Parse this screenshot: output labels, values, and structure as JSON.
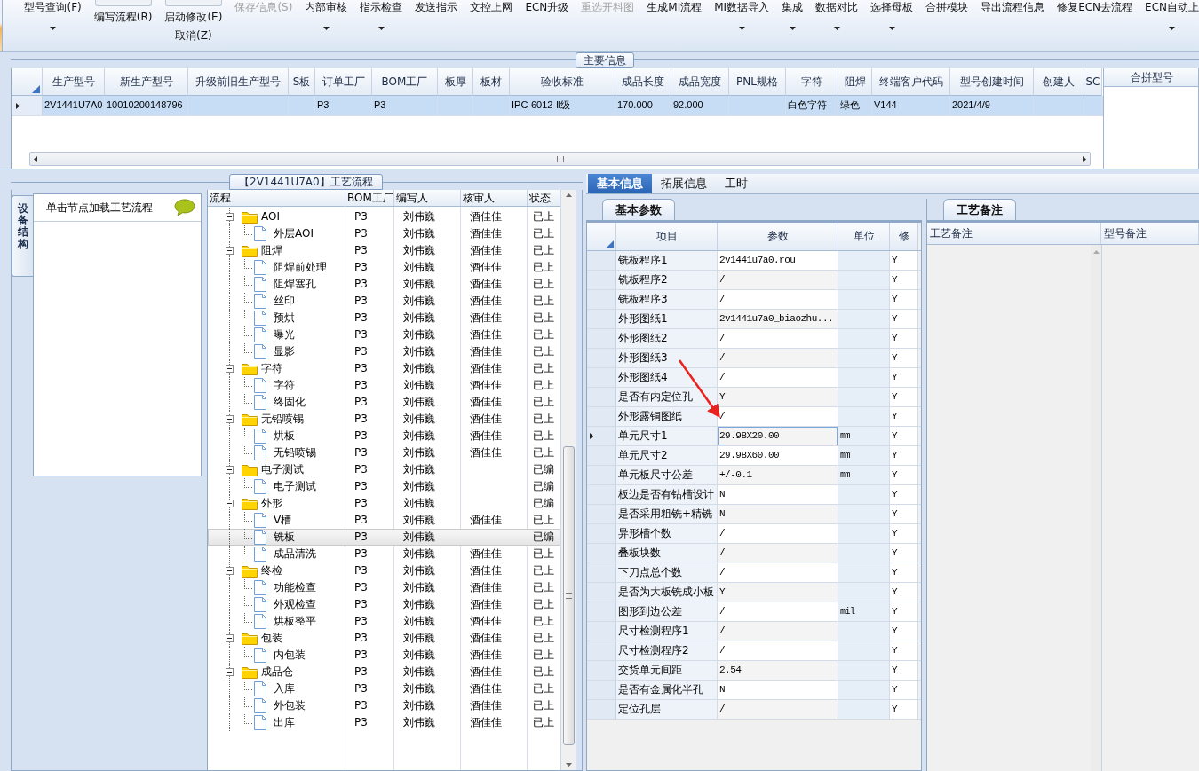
{
  "toolbar": [
    {
      "label": "型号查询(F)",
      "kind": "text",
      "dropdown": true,
      "disabled": false
    },
    {
      "label": "编写流程(R)",
      "kind": "icon",
      "dropdown": false,
      "disabled": false
    },
    {
      "label": "启动修改(E)",
      "second_label": "取消(Z)",
      "kind": "icon",
      "dropdown": false,
      "disabled": false
    },
    {
      "label": "保存信息(S)",
      "kind": "text",
      "dropdown": false,
      "disabled": true
    },
    {
      "label": "内部审核",
      "kind": "text",
      "dropdown": true,
      "disabled": false
    },
    {
      "label": "指示检查",
      "kind": "text",
      "dropdown": true,
      "disabled": false
    },
    {
      "label": "发送指示",
      "kind": "text",
      "dropdown": false,
      "disabled": false
    },
    {
      "label": "文控上网",
      "kind": "text",
      "dropdown": false,
      "disabled": false
    },
    {
      "label": "ECN升级",
      "kind": "text",
      "dropdown": false,
      "disabled": false
    },
    {
      "label": "重选开料图",
      "kind": "text",
      "dropdown": false,
      "disabled": true
    },
    {
      "label": "生成MI流程",
      "kind": "text",
      "dropdown": false,
      "disabled": false
    },
    {
      "label": "MI数据导入",
      "kind": "text",
      "dropdown": true,
      "disabled": false
    },
    {
      "label": "集成",
      "kind": "text",
      "dropdown": true,
      "disabled": false
    },
    {
      "label": "数据对比",
      "kind": "text",
      "dropdown": true,
      "disabled": false
    },
    {
      "label": "选择母板",
      "kind": "text",
      "dropdown": true,
      "disabled": false
    },
    {
      "label": "合拼模块",
      "kind": "text",
      "dropdown": false,
      "disabled": false
    },
    {
      "label": "导出流程信息",
      "kind": "text",
      "dropdown": false,
      "disabled": false
    },
    {
      "label": "修复ECN去流程",
      "kind": "text",
      "dropdown": false,
      "disabled": false
    },
    {
      "label": "ECN自动上",
      "kind": "text",
      "dropdown": true,
      "disabled": false
    }
  ],
  "main_info": {
    "title": "主要信息",
    "columns": [
      "生产型号",
      "新生产型号",
      "升级前旧生产型号",
      "S板",
      "订单工厂",
      "BOM工厂",
      "板厚",
      "板材",
      "验收标准",
      "成品长度",
      "成品宽度",
      "PNL规格",
      "字符",
      "阻焊",
      "终端客户代码",
      "型号创建时间",
      "创建人",
      "SC"
    ],
    "rows": [
      {
        "selected": true,
        "cells": [
          "2V1441U7A0",
          "10010200148796",
          null,
          null,
          "P3",
          "P3",
          null,
          null,
          "IPC-6012 Ⅱ级",
          "170.000",
          "92.000",
          null,
          "白色字符",
          "绿色",
          "V144",
          "2021/4/9",
          null,
          null
        ]
      }
    ],
    "side_column": "合拼型号"
  },
  "flow": {
    "title": "【2V1441U7A0】工艺流程",
    "side_tab": "设备结构",
    "side_hint": "单击节点加载工艺流程",
    "columns": [
      "流程",
      "BOM工厂",
      "编写人",
      "核审人",
      "状态"
    ],
    "rows": [
      {
        "name": "AOI",
        "kind": "folder",
        "expanded": true,
        "selected": false,
        "bom": "P3",
        "writer": "刘伟巍",
        "reviewer": "酒佳佳",
        "status": "已上",
        "children": [
          {
            "name": "外层AOI",
            "kind": "file",
            "selected": false,
            "bom": "P3",
            "writer": "刘伟巍",
            "reviewer": "酒佳佳",
            "status": "已上"
          }
        ]
      },
      {
        "name": "阻焊",
        "kind": "folder",
        "expanded": true,
        "selected": false,
        "bom": "P3",
        "writer": "刘伟巍",
        "reviewer": "酒佳佳",
        "status": "已上",
        "children": [
          {
            "name": "阻焊前处理",
            "kind": "file",
            "selected": false,
            "bom": "P3",
            "writer": "刘伟巍",
            "reviewer": "酒佳佳",
            "status": "已上"
          },
          {
            "name": "阻焊塞孔",
            "kind": "file",
            "selected": false,
            "bom": "P3",
            "writer": "刘伟巍",
            "reviewer": "酒佳佳",
            "status": "已上"
          },
          {
            "name": "丝印",
            "kind": "file",
            "selected": false,
            "bom": "P3",
            "writer": "刘伟巍",
            "reviewer": "酒佳佳",
            "status": "已上"
          },
          {
            "name": "预烘",
            "kind": "file",
            "selected": false,
            "bom": "P3",
            "writer": "刘伟巍",
            "reviewer": "酒佳佳",
            "status": "已上"
          },
          {
            "name": "曝光",
            "kind": "file",
            "selected": false,
            "bom": "P3",
            "writer": "刘伟巍",
            "reviewer": "酒佳佳",
            "status": "已上"
          },
          {
            "name": "显影",
            "kind": "file",
            "selected": false,
            "bom": "P3",
            "writer": "刘伟巍",
            "reviewer": "酒佳佳",
            "status": "已上"
          }
        ]
      },
      {
        "name": "字符",
        "kind": "folder",
        "expanded": true,
        "selected": false,
        "bom": "P3",
        "writer": "刘伟巍",
        "reviewer": "酒佳佳",
        "status": "已上",
        "children": [
          {
            "name": "字符",
            "kind": "file",
            "selected": false,
            "bom": "P3",
            "writer": "刘伟巍",
            "reviewer": "酒佳佳",
            "status": "已上"
          },
          {
            "name": "终固化",
            "kind": "file",
            "selected": false,
            "bom": "P3",
            "writer": "刘伟巍",
            "reviewer": "酒佳佳",
            "status": "已上"
          }
        ]
      },
      {
        "name": "无铅喷锡",
        "kind": "folder",
        "expanded": true,
        "selected": false,
        "bom": "P3",
        "writer": "刘伟巍",
        "reviewer": "酒佳佳",
        "status": "已上",
        "children": [
          {
            "name": "烘板",
            "kind": "file",
            "selected": false,
            "bom": "P3",
            "writer": "刘伟巍",
            "reviewer": "酒佳佳",
            "status": "已上"
          },
          {
            "name": "无铅喷锡",
            "kind": "file",
            "selected": false,
            "bom": "P3",
            "writer": "刘伟巍",
            "reviewer": "酒佳佳",
            "status": "已上"
          }
        ]
      },
      {
        "name": "电子测试",
        "kind": "folder",
        "expanded": true,
        "selected": false,
        "bom": "P3",
        "writer": "刘伟巍",
        "status": "已编",
        "children": [
          {
            "name": "电子测试",
            "kind": "file",
            "selected": false,
            "bom": "P3",
            "writer": "刘伟巍",
            "status": "已编"
          }
        ]
      },
      {
        "name": "外形",
        "kind": "folder",
        "expanded": true,
        "selected": false,
        "bom": "P3",
        "writer": "刘伟巍",
        "status": "已编",
        "children": [
          {
            "name": "V槽",
            "kind": "file",
            "selected": false,
            "bom": "P3",
            "writer": "刘伟巍",
            "reviewer": "酒佳佳",
            "status": "已上"
          },
          {
            "name": "铣板",
            "kind": "file",
            "selected": true,
            "bom": "P3",
            "writer": "刘伟巍",
            "status": "已编"
          },
          {
            "name": "成品清洗",
            "kind": "file",
            "selected": false,
            "bom": "P3",
            "writer": "刘伟巍",
            "reviewer": "酒佳佳",
            "status": "已上"
          }
        ]
      },
      {
        "name": "终检",
        "kind": "folder",
        "expanded": true,
        "selected": false,
        "bom": "P3",
        "writer": "刘伟巍",
        "reviewer": "酒佳佳",
        "status": "已上",
        "children": [
          {
            "name": "功能检查",
            "kind": "file",
            "selected": false,
            "bom": "P3",
            "writer": "刘伟巍",
            "reviewer": "酒佳佳",
            "status": "已上"
          },
          {
            "name": "外观检查",
            "kind": "file",
            "selected": false,
            "bom": "P3",
            "writer": "刘伟巍",
            "reviewer": "酒佳佳",
            "status": "已上"
          },
          {
            "name": "烘板整平",
            "kind": "file",
            "selected": false,
            "bom": "P3",
            "writer": "刘伟巍",
            "reviewer": "酒佳佳",
            "status": "已上"
          }
        ]
      },
      {
        "name": "包装",
        "kind": "folder",
        "expanded": true,
        "selected": false,
        "bom": "P3",
        "writer": "刘伟巍",
        "reviewer": "酒佳佳",
        "status": "已上",
        "children": [
          {
            "name": "内包装",
            "kind": "file",
            "selected": false,
            "bom": "P3",
            "writer": "刘伟巍",
            "reviewer": "酒佳佳",
            "status": "已上"
          }
        ]
      },
      {
        "name": "成品仓",
        "kind": "folder",
        "expanded": true,
        "selected": false,
        "bom": "P3",
        "writer": "刘伟巍",
        "reviewer": "酒佳佳",
        "status": "已上",
        "children": [
          {
            "name": "入库",
            "kind": "file",
            "selected": false,
            "bom": "P3",
            "writer": "刘伟巍",
            "reviewer": "酒佳佳",
            "status": "已上"
          },
          {
            "name": "外包装",
            "kind": "file",
            "selected": false,
            "bom": "P3",
            "writer": "刘伟巍",
            "reviewer": "酒佳佳",
            "status": "已上"
          },
          {
            "name": "出库",
            "kind": "file",
            "selected": false,
            "bom": "P3",
            "writer": "刘伟巍",
            "reviewer": "酒佳佳",
            "status": "已上"
          }
        ]
      }
    ]
  },
  "detail": {
    "tabs": [
      {
        "label": "基本信息",
        "selected": true
      },
      {
        "label": "拓展信息",
        "selected": false
      },
      {
        "label": "工时",
        "selected": false
      }
    ],
    "params_tab": "基本参数",
    "columns": [
      "项目",
      "参数",
      "单位",
      "修"
    ],
    "rows": [
      {
        "item": "铣板程序1",
        "value": "2v1441u7a0.rou",
        "flag": "Y",
        "selected": false
      },
      {
        "item": "铣板程序2",
        "value": "/",
        "flag": "Y",
        "selected": false
      },
      {
        "item": "铣板程序3",
        "value": "/",
        "flag": "Y",
        "selected": false
      },
      {
        "item": "外形图纸1",
        "value": "2v1441u7a0_biaozhu...",
        "flag": "Y",
        "selected": false
      },
      {
        "item": "外形图纸2",
        "value": "/",
        "flag": "Y",
        "selected": false
      },
      {
        "item": "外形图纸3",
        "value": "/",
        "flag": "Y",
        "selected": false
      },
      {
        "item": "外形图纸4",
        "value": "/",
        "flag": "Y",
        "selected": false
      },
      {
        "item": "是否有内定位孔",
        "value": "Y",
        "flag": "Y",
        "selected": false
      },
      {
        "item": "外形露铜图纸",
        "value": "/",
        "flag": "Y",
        "selected": false
      },
      {
        "item": "单元尺寸1",
        "value": "29.98X20.00",
        "unit": "mm",
        "flag": "Y",
        "selected": true
      },
      {
        "item": "单元尺寸2",
        "value": "29.98X60.00",
        "unit": "mm",
        "flag": "Y",
        "selected": false
      },
      {
        "item": "单元板尺寸公差",
        "value": "+/-0.1",
        "unit": "mm",
        "flag": "Y",
        "selected": false
      },
      {
        "item": "板边是否有钻槽设计",
        "value": "N",
        "flag": "Y",
        "selected": false
      },
      {
        "item": "是否采用粗铣+精铣",
        "value": "N",
        "flag": "Y",
        "selected": false
      },
      {
        "item": "异形槽个数",
        "value": "/",
        "flag": "Y",
        "selected": false
      },
      {
        "item": "叠板块数",
        "value": "/",
        "flag": "Y",
        "selected": false
      },
      {
        "item": "下刀点总个数",
        "value": "/",
        "flag": "Y",
        "selected": false
      },
      {
        "item": "是否为大板铣成小板",
        "value": "Y",
        "flag": "Y",
        "selected": false
      },
      {
        "item": "图形到边公差",
        "value": "/",
        "unit": "mil",
        "flag": "Y",
        "selected": false
      },
      {
        "item": "尺寸检测程序1",
        "value": "/",
        "flag": "Y",
        "selected": false
      },
      {
        "item": "尺寸检测程序2",
        "value": "/",
        "flag": "Y",
        "selected": false
      },
      {
        "item": "交货单元间距",
        "value": "2.54",
        "flag": "Y",
        "selected": false
      },
      {
        "item": "是否有金属化半孔",
        "value": "N",
        "flag": "Y",
        "selected": false
      },
      {
        "item": "定位孔层",
        "value": "/",
        "flag": "Y",
        "selected": false
      }
    ],
    "notes_tab": "工艺备注",
    "notes_columns": [
      "工艺备注",
      "型号备注"
    ]
  }
}
